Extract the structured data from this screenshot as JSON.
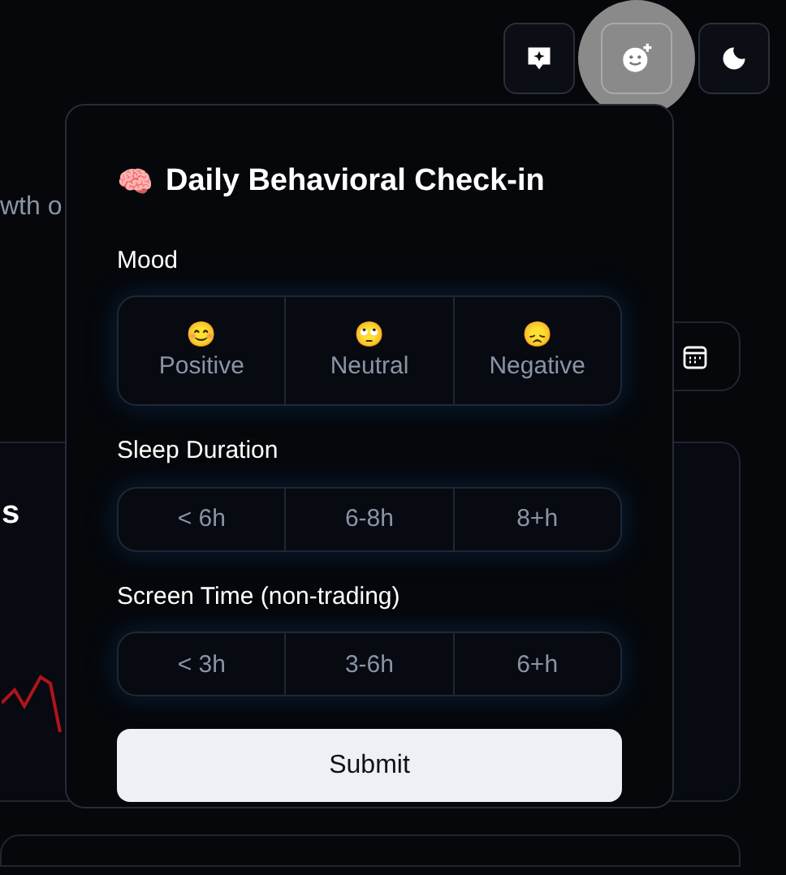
{
  "toolbar": [
    {
      "kind": "feedback",
      "active": false
    },
    {
      "kind": "checkin",
      "active": true
    },
    {
      "kind": "theme",
      "active": false
    }
  ],
  "background": {
    "subtitle": "wth o",
    "card_title": "s"
  },
  "checkin": {
    "icon": "🧠",
    "title": "Daily Behavioral Check-in",
    "groups": [
      {
        "label": "Mood",
        "options": [
          {
            "emoji": "😊",
            "label": "Positive",
            "selected": false
          },
          {
            "emoji": "🙄",
            "label": "Neutral",
            "selected": false
          },
          {
            "emoji": "😞",
            "label": "Negative",
            "selected": false
          }
        ]
      },
      {
        "label": "Sleep Duration",
        "options": [
          {
            "label": "< 6h",
            "selected": false
          },
          {
            "label": "6-8h",
            "selected": false
          },
          {
            "label": "8+h",
            "selected": false
          }
        ]
      },
      {
        "label": "Screen Time (non-trading)",
        "options": [
          {
            "label": "< 3h",
            "selected": false
          },
          {
            "label": "3-6h",
            "selected": false
          },
          {
            "label": "6+h",
            "selected": false
          }
        ]
      }
    ],
    "submit": "Submit"
  }
}
